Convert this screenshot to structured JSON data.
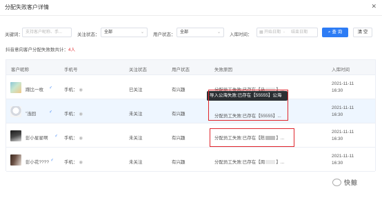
{
  "dialog": {
    "title": "分配失败客户详情",
    "close_symbol": "✕"
  },
  "filters": {
    "keyword_label": "关键词：",
    "keyword_placeholder": "支持客户昵称、手...",
    "follow_label": "关注状态：",
    "follow_value": "全部",
    "user_label": "用户状态：",
    "user_value": "全部",
    "date_label": "入库时间：",
    "date_start": "开始日期",
    "date_sep": "-",
    "date_end": "结束日期",
    "search_label": "查 询",
    "clear_label": "清 空"
  },
  "stats": {
    "label": "抖音意向客户分配失败数共计：",
    "count": "4人"
  },
  "table": {
    "headers": [
      "客户昵称",
      "手机号",
      "关注状态",
      "用户状态",
      "失败原因",
      "入库时间"
    ],
    "rows": [
      {
        "name": "蹭比一枚",
        "gender": "♂",
        "phone": "手机：",
        "follow": "已关注",
        "user": "有兴趣",
        "reason": "分配员工失败:已存在【马",
        "reason_tail": "】...",
        "date": "2021-11-11",
        "time": "16:30",
        "highlight": false
      },
      {
        "name": "˚浅回",
        "gender": "♂",
        "phone": "手机：",
        "follow": "未关注",
        "user": "有兴趣",
        "reason": "分配员工失败:已存在【55555】...",
        "reason_tail": "",
        "date": "2021-11-11",
        "time": "16:30",
        "highlight": true
      },
      {
        "name": "彭小星星啊",
        "gender": "♂",
        "phone": "手机：",
        "follow": "未关注",
        "user": "有兴趣",
        "reason": "分配员工失败:已存在【陈",
        "reason_tail": "】...",
        "date": "2021-11-11",
        "time": "16:30",
        "highlight": false
      },
      {
        "name": "彭小花????",
        "gender": "♂",
        "phone": "手机：",
        "follow": "未关注",
        "user": "有兴趣",
        "reason": "分配员工失败:已存在【周",
        "reason_tail": "】...",
        "date": "2021-11-11",
        "time": "16:30",
        "highlight": false
      }
    ]
  },
  "tooltip": {
    "text": "导入公海失败:已存在【55555】公海"
  },
  "watermark": {
    "text": "快鲸"
  },
  "colors": {
    "primary": "#2d7cf5",
    "danger": "#e0232a",
    "highlight_row": "#eef6ff"
  }
}
